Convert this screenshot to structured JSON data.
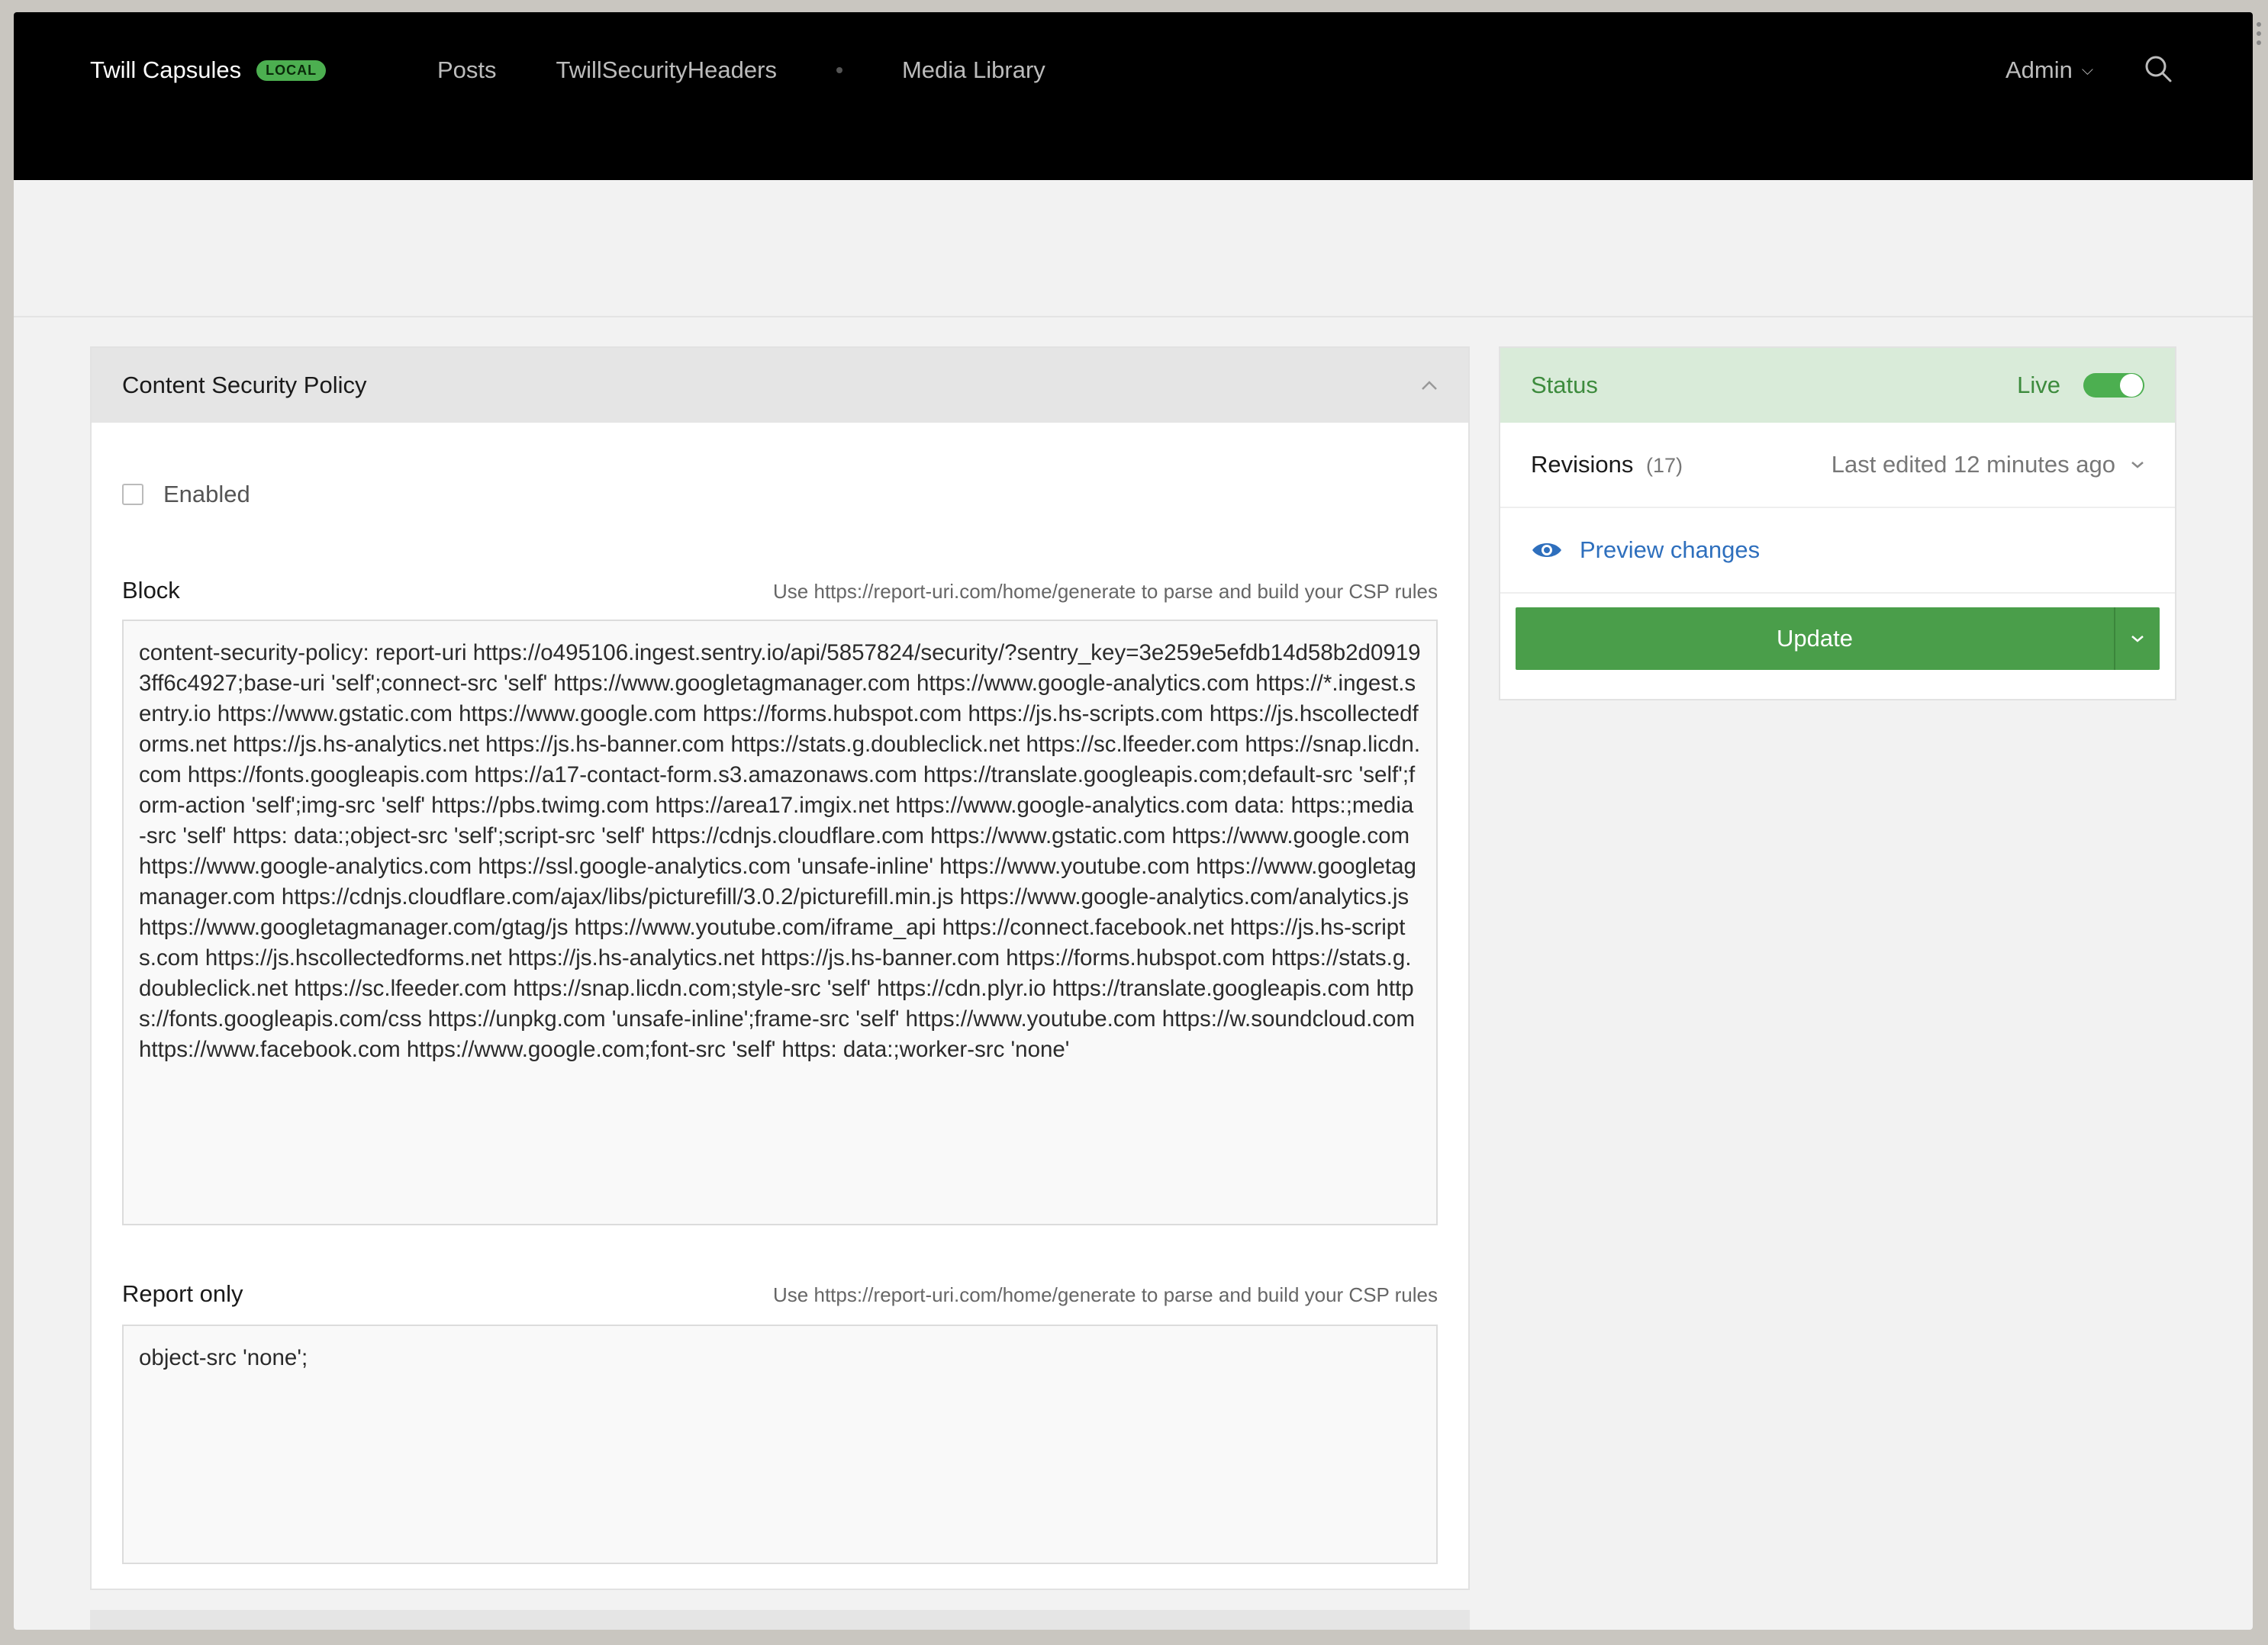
{
  "header": {
    "brand": "Twill Capsules",
    "env_badge": "LOCAL",
    "nav": [
      "Posts",
      "TwillSecurityHeaders",
      "Media Library"
    ],
    "user": "Admin"
  },
  "csp_panel": {
    "title": "Content Security Policy",
    "enabled_label": "Enabled",
    "block": {
      "label": "Block",
      "hint": "Use https://report-uri.com/home/generate to parse and build your CSP rules",
      "value": "content-security-policy: report-uri https://o495106.ingest.sentry.io/api/5857824/security/?sentry_key=3e259e5efdb14d58b2d09193ff6c4927;base-uri 'self';connect-src 'self' https://www.googletagmanager.com https://www.google-analytics.com https://*.ingest.sentry.io https://www.gstatic.com https://www.google.com https://forms.hubspot.com https://js.hs-scripts.com https://js.hscollectedforms.net https://js.hs-analytics.net https://js.hs-banner.com https://stats.g.doubleclick.net https://sc.lfeeder.com https://snap.licdn.com https://fonts.googleapis.com https://a17-contact-form.s3.amazonaws.com https://translate.googleapis.com;default-src 'self';form-action 'self';img-src 'self' https://pbs.twimg.com https://area17.imgix.net https://www.google-analytics.com data: https:;media-src 'self' https: data:;object-src 'self';script-src 'self' https://cdnjs.cloudflare.com https://www.gstatic.com https://www.google.com https://www.google-analytics.com https://ssl.google-analytics.com 'unsafe-inline' https://www.youtube.com https://www.googletagmanager.com https://cdnjs.cloudflare.com/ajax/libs/picturefill/3.0.2/picturefill.min.js https://www.google-analytics.com/analytics.js https://www.googletagmanager.com/gtag/js https://www.youtube.com/iframe_api https://connect.facebook.net https://js.hs-scripts.com https://js.hscollectedforms.net https://js.hs-analytics.net https://js.hs-banner.com https://forms.hubspot.com https://stats.g.doubleclick.net https://sc.lfeeder.com https://snap.licdn.com;style-src 'self' https://cdn.plyr.io https://translate.googleapis.com https://fonts.googleapis.com/css https://unpkg.com 'unsafe-inline';frame-src 'self' https://www.youtube.com https://w.soundcloud.com https://www.facebook.com https://www.google.com;font-src 'self' https: data:;worker-src 'none'"
    },
    "report_only": {
      "label": "Report only",
      "hint": "Use https://report-uri.com/home/generate to parse and build your CSP rules",
      "value": "object-src 'none';"
    }
  },
  "sidebar": {
    "status_label": "Status",
    "live_label": "Live",
    "live_on": true,
    "revisions_label": "Revisions",
    "revisions_count": "(17)",
    "last_edited": "Last edited 12 minutes ago",
    "preview_label": "Preview changes",
    "update_label": "Update"
  },
  "colors": {
    "accent_green": "#4a9e4a",
    "link_blue": "#2e6fbd"
  }
}
